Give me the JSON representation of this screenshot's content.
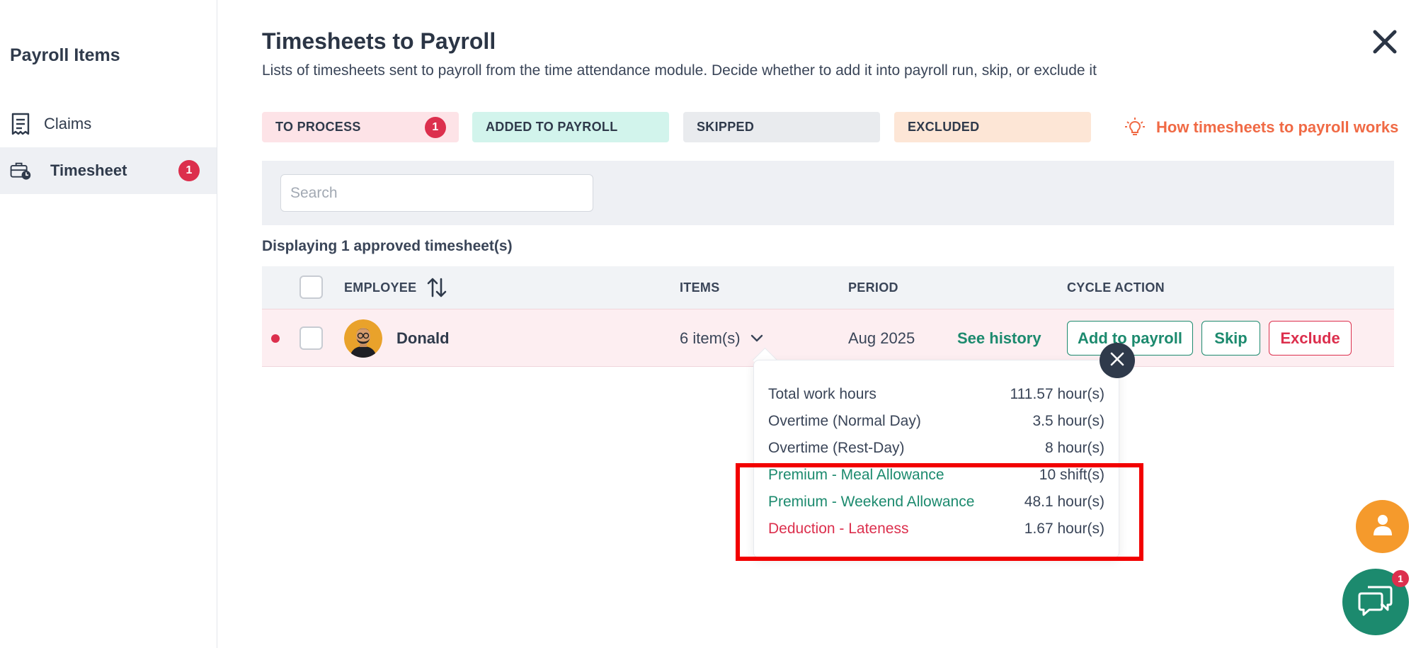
{
  "sidebar": {
    "title": "Payroll Items",
    "items": [
      {
        "label": "Claims",
        "icon": "receipt-icon"
      },
      {
        "label": "Timesheet",
        "icon": "timesheet-briefcase-icon",
        "badge": "1"
      }
    ]
  },
  "header": {
    "title": "Timesheets to Payroll",
    "subtitle": "Lists of timesheets sent to payroll from the time attendance module. Decide whether to add it into payroll run, skip, or exclude it"
  },
  "tabs": [
    {
      "label": "TO PROCESS",
      "badge": "1",
      "color": "#fde3e7"
    },
    {
      "label": "ADDED TO PAYROLL",
      "color": "#d2f4ec"
    },
    {
      "label": "SKIPPED",
      "color": "#e9ebee"
    },
    {
      "label": "EXCLUDED",
      "color": "#fde6d6"
    }
  ],
  "how_link": {
    "label": "How timesheets to payroll works",
    "icon": "lightbulb-icon"
  },
  "search": {
    "placeholder": "Search",
    "value": ""
  },
  "displaying_text": "Displaying 1 approved timesheet(s)",
  "table": {
    "columns": {
      "employee": "EMPLOYEE",
      "items": "ITEMS",
      "period": "PERIOD",
      "cycle_action": "CYCLE ACTION"
    },
    "rows": [
      {
        "name": "Donald",
        "items": "6 item(s)",
        "period": "Aug 2025",
        "history": "See history",
        "actions": {
          "add": "Add to payroll",
          "skip": "Skip",
          "exclude": "Exclude"
        }
      }
    ]
  },
  "item_details": [
    {
      "label": "Total work hours",
      "value": "111.57 hour(s)",
      "kind": "neutral"
    },
    {
      "label": "Overtime (Normal Day)",
      "value": "3.5 hour(s)",
      "kind": "neutral"
    },
    {
      "label": "Overtime (Rest-Day)",
      "value": "8 hour(s)",
      "kind": "neutral"
    },
    {
      "label": "Premium - Meal Allowance",
      "value": "10 shift(s)",
      "kind": "premium"
    },
    {
      "label": "Premium - Weekend Allowance",
      "value": "48.1 hour(s)",
      "kind": "premium"
    },
    {
      "label": "Deduction - Lateness",
      "value": "1.67 hour(s)",
      "kind": "deduction"
    }
  ],
  "chat": {
    "badge": "1"
  },
  "colors": {
    "accent_green": "#1c8a6e",
    "accent_red": "#dc2f4d",
    "accent_orange": "#f06a45",
    "highlight": "#f20000"
  }
}
